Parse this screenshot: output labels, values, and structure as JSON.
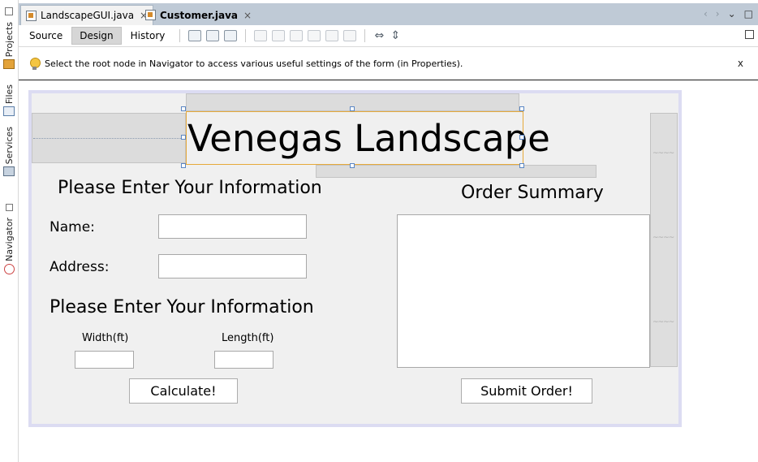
{
  "side_panel": {
    "projects": "Projects",
    "files": "Files",
    "services": "Services",
    "navigator": "Navigator"
  },
  "tabs": [
    {
      "label": "LandscapeGUI.java",
      "close": "×"
    },
    {
      "label": "Customer.java",
      "close": "×"
    }
  ],
  "tab_nav": [
    "‹",
    "›",
    "⌄",
    "□"
  ],
  "toolbar": {
    "modes": [
      "Source",
      "Design",
      "History"
    ],
    "active_mode": "Design"
  },
  "hint": {
    "text": "Select the root node in Navigator to access various useful settings of the form (in Properties).",
    "close": "x"
  },
  "form": {
    "title": "Venegas Landscape",
    "info_heading": "Please Enter Your Information",
    "name_label": "Name:",
    "name_value": "",
    "address_label": "Address:",
    "address_value": "",
    "info_heading_2": "Please Enter Your Information",
    "width_label": "Width(ft)",
    "width_value": "",
    "length_label": "Length(ft)",
    "length_value": "",
    "calculate_button": "Calculate!",
    "order_summary_heading": "Order Summary",
    "order_summary_value": "",
    "submit_button": "Submit Order!"
  },
  "colors": {
    "tab_bar": "#bfcad6",
    "selection_border": "#e6a93a",
    "form_background": "#f0f0f0",
    "form_frame": "#dcdcf2"
  }
}
